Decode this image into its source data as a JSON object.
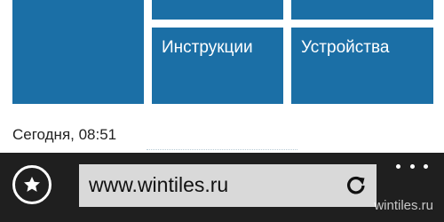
{
  "tiles": {
    "instructions_label": "Инструкции",
    "devices_label": "Устройства",
    "color": "#1b6fa6"
  },
  "feed": {
    "timestamp": "Сегодня, 08:51"
  },
  "browser_bar": {
    "favorites_icon": "star-icon",
    "url": "www.wintiles.ru",
    "refresh_icon": "refresh-icon",
    "more_icon": "more-dots-icon"
  },
  "watermark": "wintiles.ru"
}
